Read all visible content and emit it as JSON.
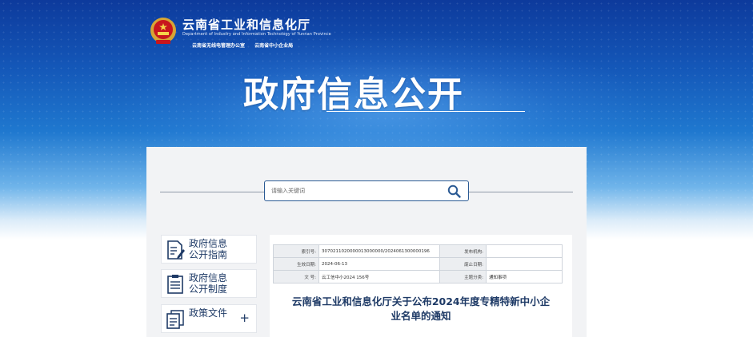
{
  "header": {
    "org_title": "云南省工业和信息化厅",
    "org_subtitle": "Department of Industry and Information Technology of Yunnan Province",
    "links": [
      "云南省无线电管理办公室",
      "云南省中小企业局"
    ],
    "hero_title": "政府信息公开"
  },
  "search": {
    "placeholder": "请输入关键词"
  },
  "sidebar": {
    "items": [
      {
        "label_line1": "政府信息",
        "label_line2": "公开指南",
        "icon": "document-edit-icon"
      },
      {
        "label_line1": "政府信息",
        "label_line2": "公开制度",
        "icon": "clipboard-list-icon"
      },
      {
        "label_line1": "政策文件",
        "label_line2": "",
        "icon": "documents-stack-icon",
        "expandable": "+"
      }
    ]
  },
  "document": {
    "meta": {
      "index_label": "索引号:",
      "index_value": "3070211020000013000000/2024061300000196",
      "publisher_label": "发布机构:",
      "publisher_value": "",
      "effective_label": "生效日期:",
      "effective_value": "2024-06-13",
      "expire_label": "废止日期:",
      "expire_value": "",
      "docno_label": "文 号:",
      "docno_value": "云工信中小2024 156号",
      "topic_label": "主题分类:",
      "topic_value": "通知事项"
    },
    "title_line1": "云南省工业和信息化厅关于公布2024年度专精特新中小企",
    "title_line2": "业名单的通知"
  },
  "colors": {
    "accent": "#1e3a66",
    "hero_top": "#0d3a9c",
    "hero_mid": "#1f78cf",
    "panel_bg": "#f2f3f5"
  }
}
